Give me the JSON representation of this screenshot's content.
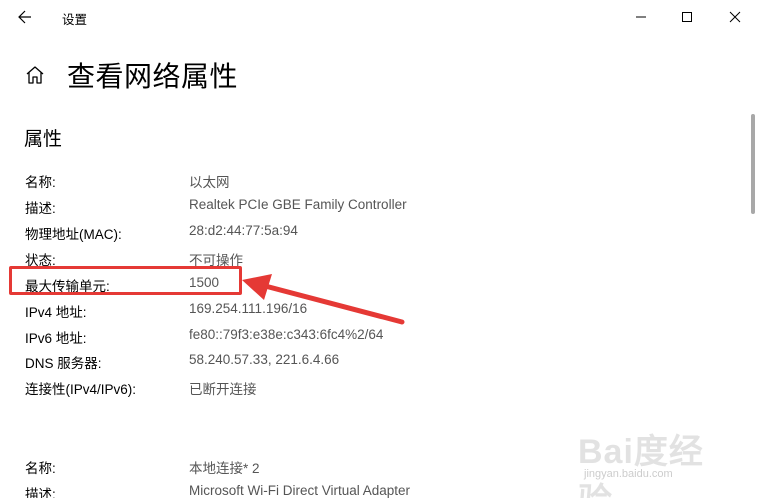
{
  "window": {
    "app_title": "设置"
  },
  "header": {
    "page_title": "查看网络属性",
    "section_title": "属性"
  },
  "properties": [
    {
      "label": "名称:",
      "value": "以太网"
    },
    {
      "label": "描述:",
      "value": "Realtek PCIe GBE Family Controller"
    },
    {
      "label": "物理地址(MAC):",
      "value": "28:d2:44:77:5a:94"
    },
    {
      "label": "状态:",
      "value": "不可操作"
    },
    {
      "label": "最大传输单元:",
      "value": "1500"
    },
    {
      "label": "IPv4 地址:",
      "value": "169.254.111.196/16"
    },
    {
      "label": "IPv6 地址:",
      "value": "fe80::79f3:e38e:c343:6fc4%2/64"
    },
    {
      "label": "DNS 服务器:",
      "value": "58.240.57.33, 221.6.4.66"
    },
    {
      "label": "连接性(IPv4/IPv6):",
      "value": "已断开连接"
    },
    {
      "label": "名称:",
      "value": "本地连接* 2"
    },
    {
      "label": "描述:",
      "value": "Microsoft Wi-Fi Direct Virtual Adapter"
    }
  ],
  "annotation": {
    "color": "#e53935"
  },
  "watermark": {
    "main": "Bai度经验",
    "sub": "jingyan.baidu.com"
  },
  "icons": {
    "back": "back-arrow-icon",
    "home": "home-icon",
    "minimize": "minimize-icon",
    "maximize": "maximize-icon",
    "close": "close-icon"
  }
}
